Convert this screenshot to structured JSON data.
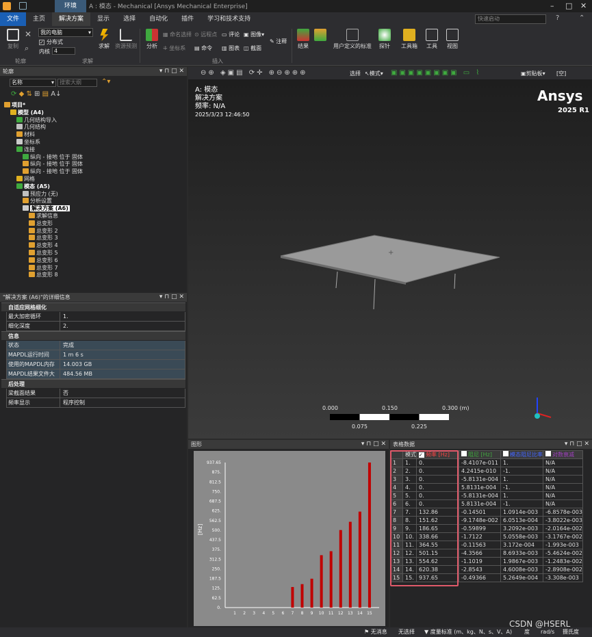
{
  "titlebar": {
    "context_tab": "环境",
    "title": "A : 模态 - Mechanical [Ansys Mechanical Enterprise]"
  },
  "menu": {
    "file": "文件",
    "items": [
      "主页",
      "解决方案",
      "显示",
      "选择",
      "自动化",
      "插件",
      "学习和技术支持"
    ],
    "search_placeholder": "快速启动"
  },
  "ribbon": {
    "copy": "复制",
    "machine": "我的电脑",
    "distributed": "分布式",
    "cores_label": "内核",
    "cores_value": "4",
    "solve": "求解",
    "resource": "资源预测",
    "analysis": "分析",
    "named_sel": "命名选择",
    "coord": "坐标系",
    "remote": "远程点",
    "comment": "评论",
    "image": "图像",
    "command": "命令",
    "chart": "图表",
    "section": "截面",
    "annotation": "注释",
    "results": "结果",
    "user_defined": "用户定义的标准",
    "probe": "探针",
    "toolbox": "工具箱",
    "tools": "工具",
    "view": "视图",
    "groups": {
      "outline": "轮廓",
      "solve": "求解",
      "insert": "插入"
    }
  },
  "outline": {
    "title": "轮廓",
    "name_label": "名称",
    "search_placeholder": "搜索大纲",
    "tree": [
      {
        "label": "项目*",
        "level": 0,
        "bold": true
      },
      {
        "label": "模型 (A4)",
        "level": 1,
        "bold": true
      },
      {
        "label": "几何结构导入",
        "level": 2
      },
      {
        "label": "几何结构",
        "level": 2
      },
      {
        "label": "材料",
        "level": 2
      },
      {
        "label": "坐标系",
        "level": 2
      },
      {
        "label": "连接",
        "level": 2
      },
      {
        "label": "纵向 - 接地 位于 固体",
        "level": 3
      },
      {
        "label": "纵向 - 接地 位于 固体",
        "level": 3
      },
      {
        "label": "纵向 - 接地 位于 固体",
        "level": 3
      },
      {
        "label": "网格",
        "level": 2
      },
      {
        "label": "模态 (A5)",
        "level": 2,
        "bold": true
      },
      {
        "label": "预应力 (无)",
        "level": 3
      },
      {
        "label": "分析设置",
        "level": 3
      },
      {
        "label": "解决方案 (A6)",
        "level": 3,
        "bold": true,
        "selected": true
      },
      {
        "label": "求解信息",
        "level": 4
      },
      {
        "label": "总变形",
        "level": 4
      },
      {
        "label": "总变形 2",
        "level": 4
      },
      {
        "label": "总变形 3",
        "level": 4
      },
      {
        "label": "总变形 4",
        "level": 4
      },
      {
        "label": "总变形 5",
        "level": 4
      },
      {
        "label": "总变形 6",
        "level": 4
      },
      {
        "label": "总变形 7",
        "level": 4
      },
      {
        "label": "总变形 8",
        "level": 4
      }
    ]
  },
  "details": {
    "title": "\"解决方案 (A6)\"的详细信息",
    "sections": [
      {
        "name": "自适应网格细化",
        "rows": [
          [
            "最大加密循环",
            "1."
          ],
          [
            "细化深度",
            "2."
          ]
        ]
      },
      {
        "name": "信息",
        "rows": [
          [
            "状态",
            "完成"
          ],
          [
            "MAPDL运行时间",
            "1 m 6 s"
          ],
          [
            "使用的MAPDL内存",
            "14.003 GB"
          ],
          [
            "MAPDL结果文件大小",
            "484.56 MB"
          ]
        ]
      },
      {
        "name": "后处理",
        "rows": [
          [
            "梁截面结果",
            "否"
          ],
          [
            "频率显示",
            "程序控制"
          ]
        ]
      }
    ]
  },
  "viewport": {
    "model": "A: 模态",
    "type": "解决方案",
    "freq": "频率: N/A",
    "date": "2025/3/23 12:46:50",
    "brand": "Ansys",
    "version": "2025 R1",
    "scale_top": [
      "0.000",
      "0.150",
      "0.300 (m)"
    ],
    "scale_bottom": [
      "0.075",
      "0.225"
    ],
    "toolbar_select": "选择",
    "toolbar_mode": "模式",
    "toolbar_clip": "剪贴板",
    "toolbar_empty": "[空]"
  },
  "graph": {
    "title": "图形"
  },
  "chart_data": {
    "type": "bar",
    "title": "",
    "xlabel": "",
    "ylabel": "[Hz]",
    "categories": [
      "1",
      "2",
      "3",
      "4",
      "5",
      "6",
      "7",
      "8",
      "9",
      "10",
      "11",
      "12",
      "13",
      "14",
      "15"
    ],
    "values": [
      0,
      0,
      0,
      0,
      0,
      0,
      132.86,
      151.62,
      186.65,
      338.66,
      364.55,
      501.15,
      554.62,
      620.38,
      937.65
    ],
    "ylim": [
      0,
      937.65
    ],
    "yticks": [
      "0.",
      "62.5",
      "125.",
      "187.5",
      "250.",
      "312.5",
      "375.",
      "437.5",
      "500.",
      "562.5",
      "625.",
      "687.5",
      "750.",
      "812.5",
      "875.",
      "937.65"
    ],
    "xticks": [
      "1",
      "2",
      "3",
      "4",
      "5",
      "6",
      "7",
      "8",
      "9",
      "10",
      "11",
      "12",
      "13",
      "14",
      "15"
    ],
    "bar_color": "#c00000"
  },
  "table": {
    "title": "表格数据",
    "headers": [
      "模式",
      "频率 [Hz]",
      "阻尼 [Hz]",
      "模态阻尼比率",
      "对数衰减"
    ],
    "header_colors": [
      "#dddddd",
      "#ff4444",
      "#3fa93f",
      "#4466ff",
      "#a040c0"
    ],
    "rows": [
      [
        "1",
        "1.",
        "0.",
        "-8.4107e-011",
        "1.",
        "N/A"
      ],
      [
        "2",
        "2.",
        "0.",
        "4.2415e-010",
        "-1.",
        "N/A"
      ],
      [
        "3",
        "3.",
        "0.",
        "-5.8131e-004",
        "1.",
        "N/A"
      ],
      [
        "4",
        "4.",
        "0.",
        "5.8131e-004",
        "-1.",
        "N/A"
      ],
      [
        "5",
        "5.",
        "0.",
        "-5.8131e-004",
        "1.",
        "N/A"
      ],
      [
        "6",
        "6.",
        "0.",
        "5.8131e-004",
        "-1.",
        "N/A"
      ],
      [
        "7",
        "7.",
        "132.86",
        "-0.14501",
        "1.0914e-003",
        "-6.8578e-003"
      ],
      [
        "8",
        "8.",
        "151.62",
        "-9.1748e-002",
        "6.0513e-004",
        "-3.8022e-003"
      ],
      [
        "9",
        "9.",
        "186.65",
        "-0.59899",
        "3.2092e-003",
        "-2.0164e-002"
      ],
      [
        "10",
        "10.",
        "338.66",
        "-1.7122",
        "5.0558e-003",
        "-3.1767e-002"
      ],
      [
        "11",
        "11.",
        "364.55",
        "-0.11563",
        "3.172e-004",
        "-1.993e-003"
      ],
      [
        "12",
        "12.",
        "501.15",
        "-4.3566",
        "8.6933e-003",
        "-5.4624e-002"
      ],
      [
        "13",
        "13.",
        "554.62",
        "-1.1019",
        "1.9867e-003",
        "-1.2483e-002"
      ],
      [
        "14",
        "14.",
        "620.38",
        "-2.8543",
        "4.6008e-003",
        "-2.8908e-002"
      ],
      [
        "15",
        "15.",
        "937.65",
        "-0.49366",
        "5.2649e-004",
        "-3.308e-003"
      ]
    ]
  },
  "status": {
    "messages": "无消息",
    "selection": "无选择",
    "units": "度量标准 (m、kg、N、s、V、A)",
    "angle": "度",
    "rad": "rad/s",
    "temp": "摄氏度",
    "watermark": "CSDN @HSERL"
  }
}
